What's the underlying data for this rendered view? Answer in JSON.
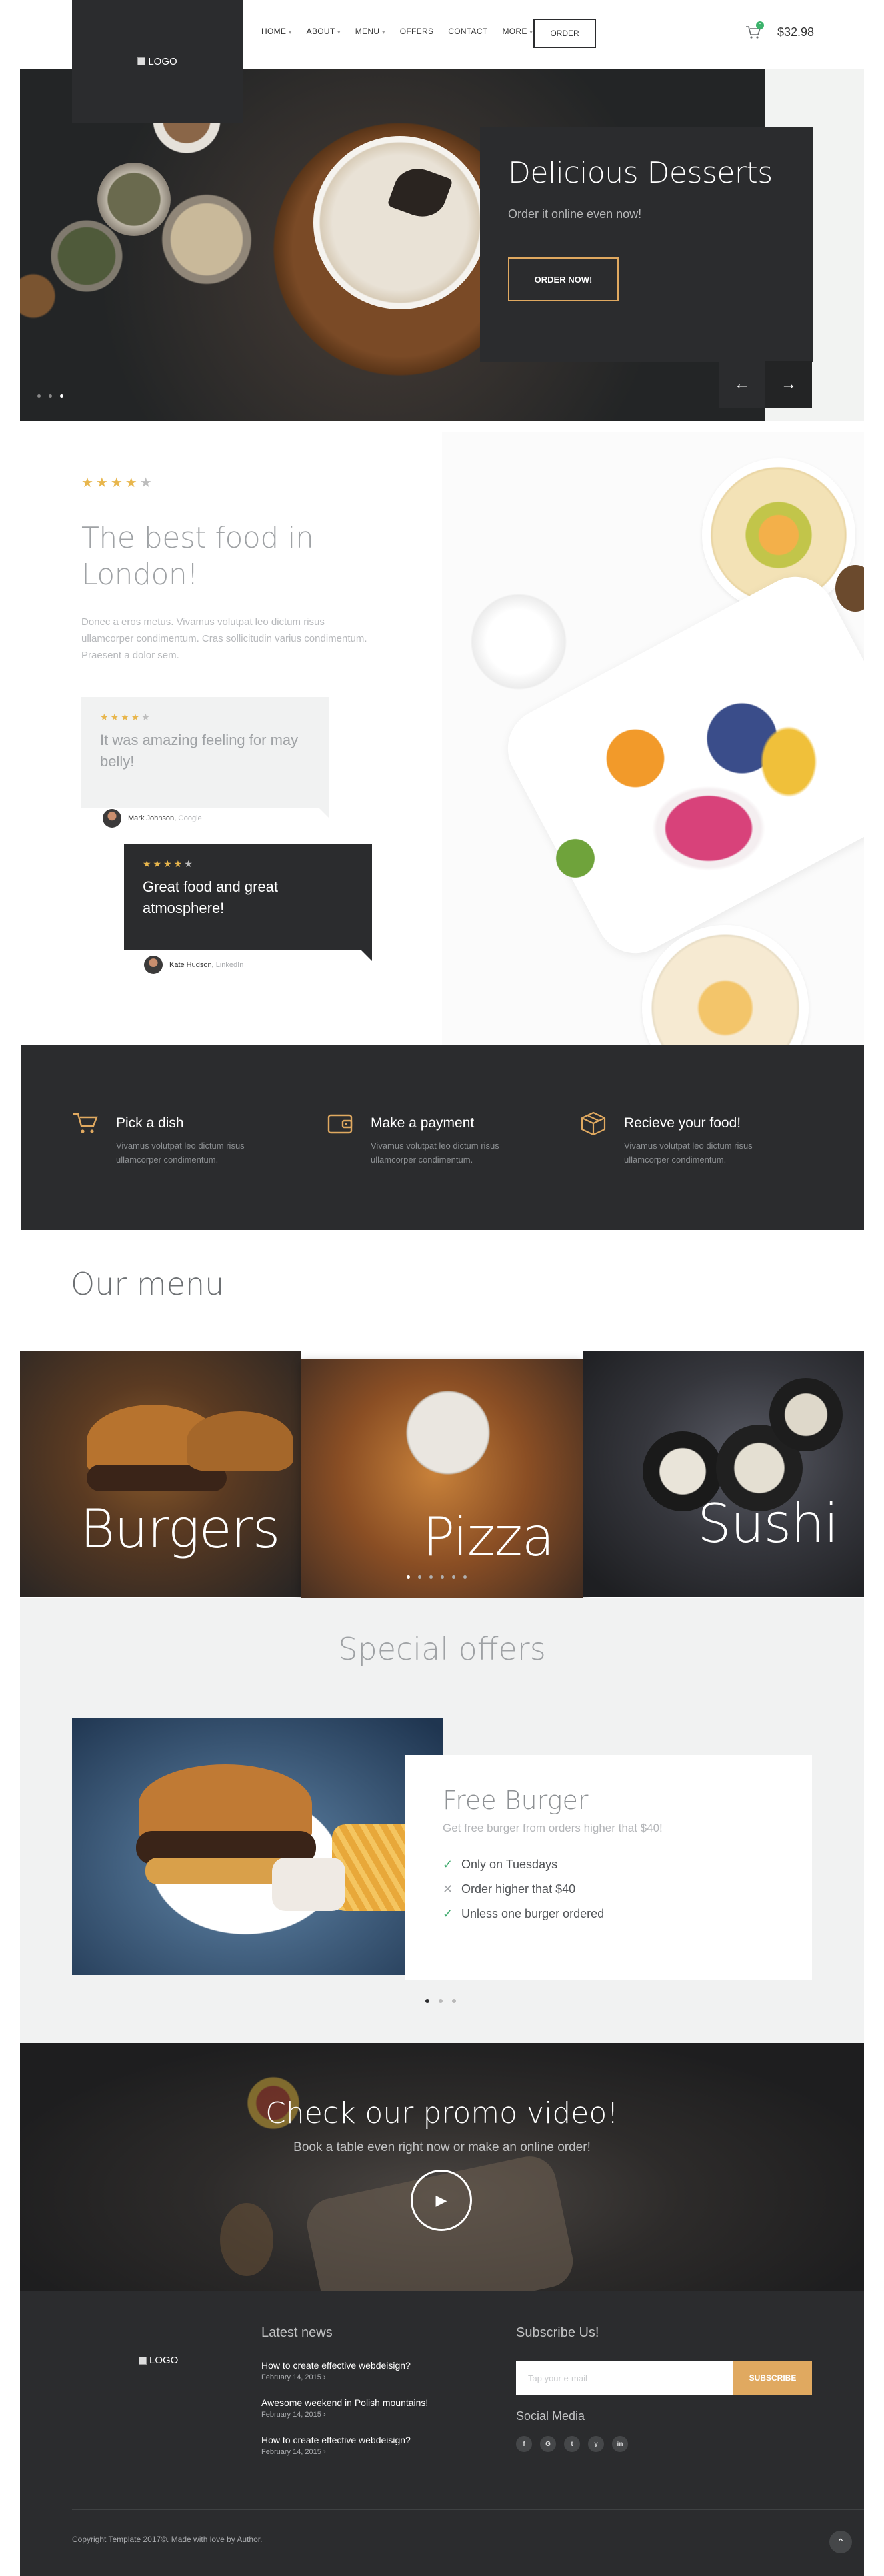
{
  "header": {
    "logo_alt": "LOGO",
    "nav": [
      "HOME",
      "ABOUT",
      "MENU",
      "OFFERS",
      "CONTACT",
      "MORE"
    ],
    "nav_dropdown_caret": "⌄",
    "order_label": "ORDER",
    "cart_count": "0",
    "cart_total": "$32.98"
  },
  "hero": {
    "title": "Delicious Desserts",
    "subtitle": "Order it online even now!",
    "button": "ORDER NOW!",
    "prev_icon": "arrow-left-icon",
    "next_icon": "arrow-right-icon"
  },
  "about": {
    "rating": 4,
    "title": "The best food in London!",
    "text": "Donec a eros metus. Vivamus volutpat leo dictum risus ullamcorper condimentum. Cras sollicitudin varius condimentum. Praesent a dolor sem.",
    "reviews": [
      {
        "rating": 4,
        "text": "It was amazing feeling for may belly!",
        "author": "Mark Johnson,",
        "site": "Google"
      },
      {
        "rating": 4,
        "text": "Great food and great atmosphere!",
        "author": "Kate Hudson,",
        "site": "LinkedIn"
      }
    ]
  },
  "steps": [
    {
      "icon": "cart-icon",
      "title": "Pick a dish",
      "text": "Vivamus volutpat leo dictum risus ullamcorper condimentum."
    },
    {
      "icon": "wallet-icon",
      "title": "Make a payment",
      "text": "Vivamus volutpat leo dictum risus ullamcorper condimentum."
    },
    {
      "icon": "box-icon",
      "title": "Recieve your food!",
      "text": "Vivamus volutpat leo dictum risus ullamcorper condimentum."
    }
  ],
  "menu": {
    "heading": "Our menu",
    "items": [
      "Burgers",
      "Pizza",
      "Sushi"
    ]
  },
  "offers": {
    "heading": "Special offers",
    "title": "Free Burger",
    "subtitle": "Get free burger from orders higher that $40!",
    "conditions": [
      {
        "text": "Only on Tuesdays",
        "met": true
      },
      {
        "text": "Order higher that $40",
        "met": false
      },
      {
        "text": "Unless one burger ordered",
        "met": true
      }
    ]
  },
  "promo": {
    "title": "Check our promo video!",
    "subtitle": "Book a table even right now or make an online order!",
    "play_icon": "play-icon"
  },
  "footer": {
    "logo_alt": "LOGO",
    "news_heading": "Latest news",
    "news": [
      {
        "title": "How to create effective webdeisign?",
        "date": "February 14, 2015"
      },
      {
        "title": "Awesome weekend in Polish mountains!",
        "date": "February 14, 2015"
      },
      {
        "title": "How to create effective webdeisign?",
        "date": "February 14, 2015"
      }
    ],
    "subscribe_heading": "Subscribe Us!",
    "email_placeholder": "Tap your e-mail",
    "subscribe_button": "SUBSCRIBE",
    "social_heading": "Social Media",
    "socials": [
      "f",
      "G",
      "t",
      "y",
      "in"
    ],
    "copyright": "Copyright Template 2017©. Made with love by Author.",
    "to_top_icon": "chevron-up-icon"
  },
  "colors": {
    "accent": "#e0a960",
    "dark": "#2b2c2e",
    "check": "#3eaa6d",
    "star": "#e8b64c"
  }
}
